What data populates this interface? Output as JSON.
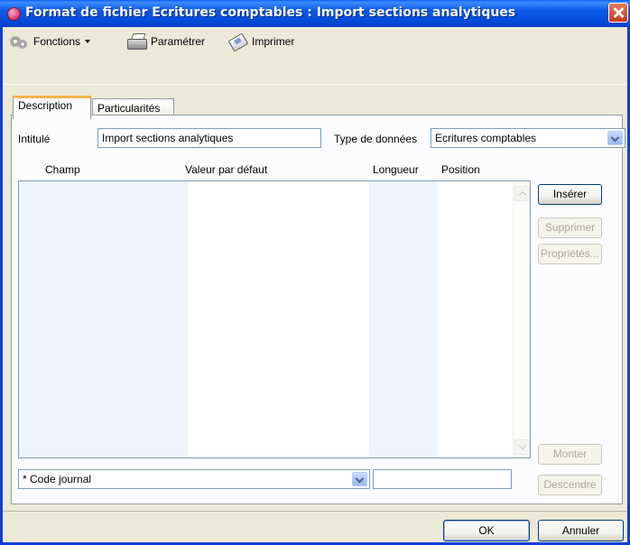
{
  "window": {
    "title": "Format de fichier Ecritures comptables : Import sections analytiques"
  },
  "toolbar": {
    "functions_label": "Fonctions",
    "settings_label": "Paramétrer",
    "print_label": "Imprimer"
  },
  "tabs": [
    {
      "label": "Description",
      "active": true
    },
    {
      "label": "Particularités",
      "active": false
    }
  ],
  "form": {
    "title_label": "Intitulé",
    "title_value": "Import sections analytiques",
    "data_type_label": "Type de données",
    "data_type_value": "Ecritures comptables"
  },
  "grid": {
    "columns": [
      "Champ",
      "Valeur par défaut",
      "Longueur",
      "Position"
    ],
    "rows": []
  },
  "side_buttons": {
    "insert": "Insérer",
    "delete": "Supprimer",
    "properties": "Propriétés...",
    "move_up": "Monter",
    "move_down": "Descendre"
  },
  "field_editor": {
    "field_value": "* Code journal",
    "default_value": ""
  },
  "dialog_buttons": {
    "ok": "OK",
    "cancel": "Annuler"
  },
  "colors": {
    "titlebar": "#0548d6",
    "active_tab_accent": "#f7b34a",
    "grid_column_tint": "#eef3fd"
  }
}
